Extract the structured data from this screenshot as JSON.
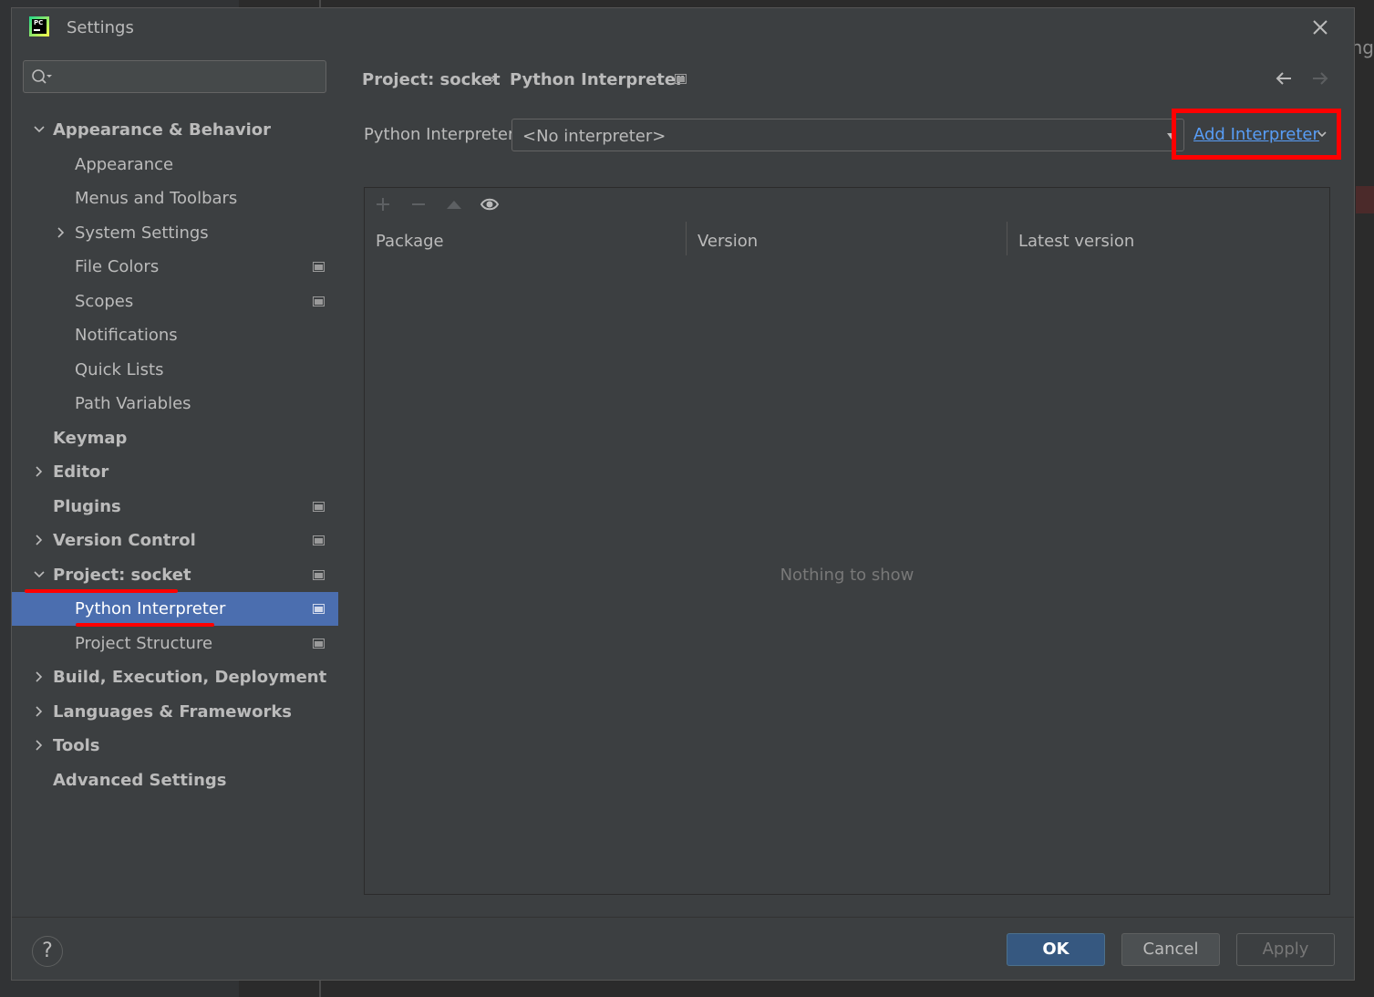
{
  "window": {
    "title": "Settings",
    "app_logo_text": "PC",
    "background_peek_text": "ng"
  },
  "sidebar": {
    "search_placeholder": "",
    "items": [
      {
        "label": "Appearance & Behavior",
        "bold": true,
        "expanded": true
      },
      {
        "label": "Appearance"
      },
      {
        "label": "Menus and Toolbars"
      },
      {
        "label": "System Settings",
        "collapsed": true
      },
      {
        "label": "File Colors",
        "project_icon": true
      },
      {
        "label": "Scopes",
        "project_icon": true
      },
      {
        "label": "Notifications"
      },
      {
        "label": "Quick Lists"
      },
      {
        "label": "Path Variables"
      },
      {
        "label": "Keymap",
        "bold": true
      },
      {
        "label": "Editor",
        "bold": true,
        "collapsed": true
      },
      {
        "label": "Plugins",
        "bold": true,
        "project_icon": true
      },
      {
        "label": "Version Control",
        "bold": true,
        "collapsed": true,
        "project_icon": true
      },
      {
        "label": "Project: socket",
        "bold": true,
        "expanded": true,
        "project_icon": true
      },
      {
        "label": "Python Interpreter",
        "selected": true,
        "project_icon": true
      },
      {
        "label": "Project Structure",
        "project_icon": true
      },
      {
        "label": "Build, Execution, Deployment",
        "bold": true,
        "collapsed": true
      },
      {
        "label": "Languages & Frameworks",
        "bold": true,
        "collapsed": true
      },
      {
        "label": "Tools",
        "bold": true,
        "collapsed": true
      },
      {
        "label": "Advanced Settings",
        "bold": true
      }
    ]
  },
  "content": {
    "breadcrumb": {
      "parent": "Project: socket",
      "separator": "›",
      "current": "Python Interpreter"
    },
    "interpreter": {
      "label": "Python Interpreter:",
      "value": "<No interpreter>",
      "add_link": "Add Interpreter"
    },
    "packages": {
      "toolbar": [
        "add-icon",
        "remove-icon",
        "upgrade-icon",
        "eye-icon"
      ],
      "columns": [
        "Package",
        "Version",
        "Latest version"
      ],
      "empty_text": "Nothing to show"
    }
  },
  "footer": {
    "help": "?",
    "ok": "OK",
    "cancel": "Cancel",
    "apply": "Apply"
  },
  "colors": {
    "selection": "#4b6eaf",
    "link": "#589df6",
    "annotation_red": "#ff0000",
    "ok_button": "#365880"
  }
}
